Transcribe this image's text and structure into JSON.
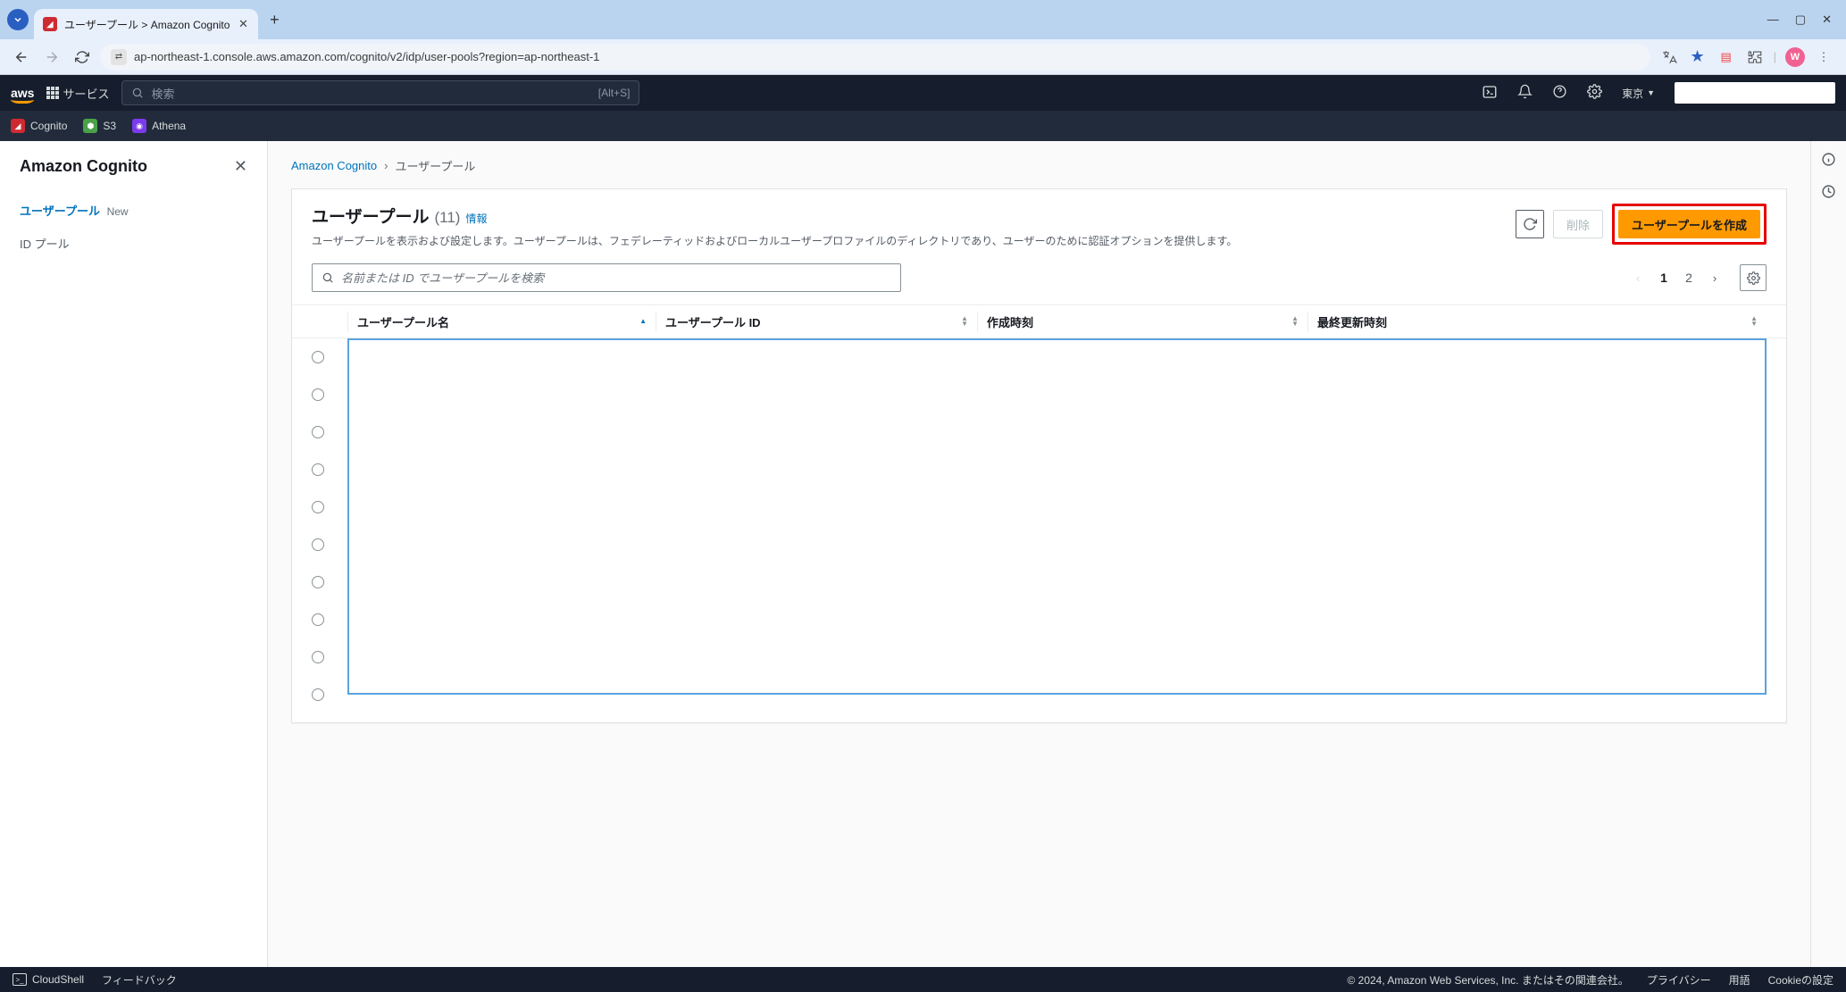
{
  "browser": {
    "tab_title": "ユーザープール > Amazon Cognito",
    "url": "ap-northeast-1.console.aws.amazon.com/cognito/v2/idp/user-pools?region=ap-northeast-1",
    "profile_initial": "W"
  },
  "aws_header": {
    "logo": "aws",
    "services_label": "サービス",
    "search_label": "検索",
    "search_hotkey": "[Alt+S]",
    "region": "東京"
  },
  "sub_nav": {
    "items": [
      {
        "label": "Cognito",
        "icon": "cognito"
      },
      {
        "label": "S3",
        "icon": "s3"
      },
      {
        "label": "Athena",
        "icon": "athena"
      }
    ]
  },
  "left_nav": {
    "title": "Amazon Cognito",
    "items": [
      {
        "label": "ユーザープール",
        "badge": "New",
        "active": true
      },
      {
        "label": "ID プール",
        "badge": "",
        "active": false
      }
    ]
  },
  "breadcrumbs": [
    {
      "label": "Amazon Cognito",
      "link": true
    },
    {
      "label": "ユーザープール",
      "link": false
    }
  ],
  "page": {
    "title": "ユーザープール",
    "count": "(11)",
    "info_label": "情報",
    "description": "ユーザープールを表示および設定します。ユーザープールは、フェデレーティッドおよびローカルユーザープロファイルのディレクトリであり、ユーザーのために認証オプションを提供します。",
    "actions": {
      "refresh": "",
      "delete": "削除",
      "create": "ユーザープールを作成"
    },
    "filter_placeholder": "名前または ID でユーザープールを検索",
    "pagination": {
      "current": "1",
      "other": "2"
    },
    "columns": {
      "name": "ユーザープール名",
      "id": "ユーザープール ID",
      "created": "作成時刻",
      "updated": "最終更新時刻"
    },
    "row_count": 10
  },
  "footer": {
    "cloudshell": "CloudShell",
    "feedback": "フィードバック",
    "copyright": "© 2024, Amazon Web Services, Inc. またはその関連会社。",
    "privacy": "プライバシー",
    "terms": "用語",
    "cookie": "Cookieの設定"
  }
}
